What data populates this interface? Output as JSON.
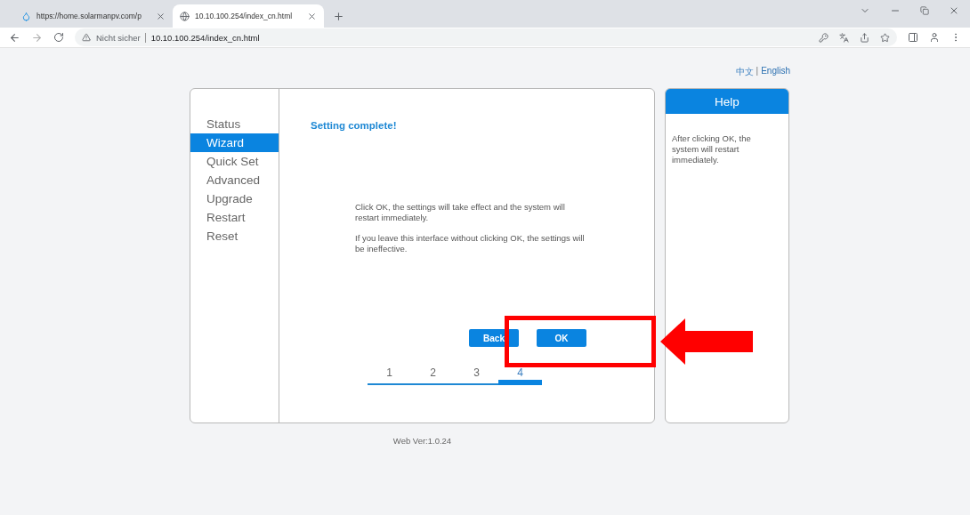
{
  "browser": {
    "tabs": [
      {
        "title": "https://home.solarmanpv.com/p",
        "selected": false
      },
      {
        "title": "10.10.100.254/index_cn.html",
        "selected": true
      }
    ],
    "security": "Nicht sicher",
    "url": "10.10.100.254/index_cn.html"
  },
  "language_links": [
    {
      "label": "中文",
      "selected": false
    },
    {
      "label": "English",
      "selected": true
    }
  ],
  "language_separator": "|",
  "sidebar": {
    "items": [
      {
        "label": "Status",
        "selected": false
      },
      {
        "label": "Wizard",
        "selected": true
      },
      {
        "label": "Quick Set",
        "selected": false
      },
      {
        "label": "Advanced",
        "selected": false
      },
      {
        "label": "Upgrade",
        "selected": false
      },
      {
        "label": "Restart",
        "selected": false
      },
      {
        "label": "Reset",
        "selected": false
      }
    ]
  },
  "content": {
    "title": "Setting complete!",
    "messages": [
      "Click OK, the settings will take effect and the system will restart immediately.",
      "If you leave this interface without clicking OK, the settings will be ineffective."
    ],
    "buttons": [
      "Back",
      "OK"
    ],
    "steps": [
      {
        "label": "1",
        "selected": false
      },
      {
        "label": "2",
        "selected": false
      },
      {
        "label": "3",
        "selected": false
      },
      {
        "label": "4",
        "selected": true
      }
    ]
  },
  "help": {
    "title": "Help",
    "text": "After clicking OK, the system will restart immediately."
  },
  "footer": "Web Ver:1.0.24"
}
